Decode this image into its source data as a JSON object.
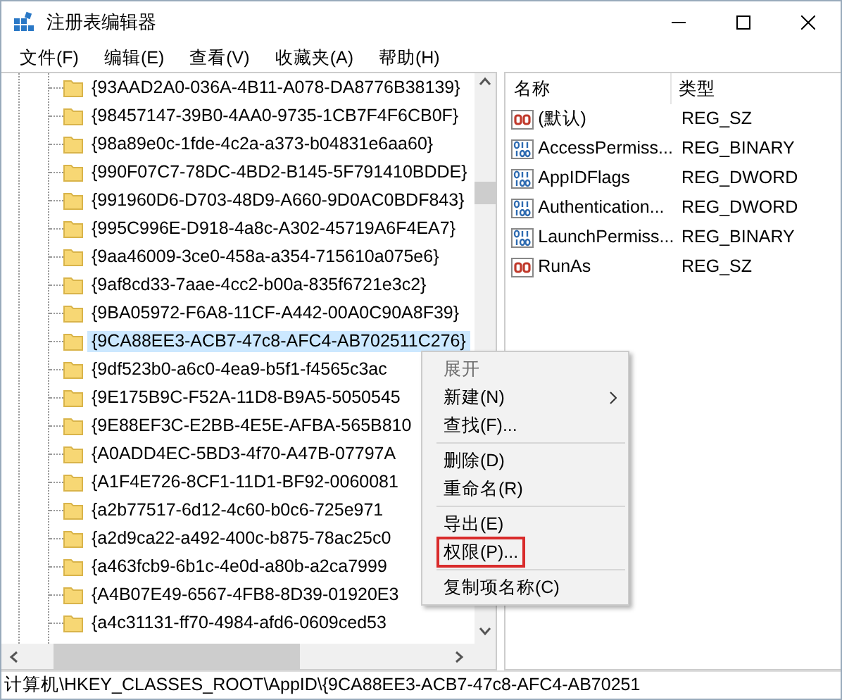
{
  "window": {
    "title": "注册表编辑器"
  },
  "menu": [
    "文件(F)",
    "编辑(E)",
    "查看(V)",
    "收藏夹(A)",
    "帮助(H)"
  ],
  "tree": {
    "items": [
      {
        "label": "{93AAD2A0-036A-4B11-A078-DA8776B38139}",
        "selected": false
      },
      {
        "label": "{98457147-39B0-4AA0-9735-1CB7F4F6CB0F}",
        "selected": false
      },
      {
        "label": "{98a89e0c-1fde-4c2a-a373-b04831e6aa60}",
        "selected": false
      },
      {
        "label": "{990F07C7-78DC-4BD2-B145-5F791410BDDE}",
        "selected": false
      },
      {
        "label": "{991960D6-D703-48D9-A660-9D0AC0BDF843}",
        "selected": false
      },
      {
        "label": "{995C996E-D918-4a8c-A302-45719A6F4EA7}",
        "selected": false
      },
      {
        "label": "{9aa46009-3ce0-458a-a354-715610a075e6}",
        "selected": false
      },
      {
        "label": "{9af8cd33-7aae-4cc2-b00a-835f6721e3c2}",
        "selected": false
      },
      {
        "label": "{9BA05972-F6A8-11CF-A442-00A0C90A8F39}",
        "selected": false
      },
      {
        "label": "{9CA88EE3-ACB7-47c8-AFC4-AB702511C276}",
        "selected": true
      },
      {
        "label": "{9df523b0-a6c0-4ea9-b5f1-f4565c3ac",
        "selected": false
      },
      {
        "label": "{9E175B9C-F52A-11D8-B9A5-5050545",
        "selected": false
      },
      {
        "label": "{9E88EF3C-E2BB-4E5E-AFBA-565B810",
        "selected": false
      },
      {
        "label": "{A0ADD4EC-5BD3-4f70-A47B-07797A",
        "selected": false
      },
      {
        "label": "{A1F4E726-8CF1-11D1-BF92-0060081",
        "selected": false
      },
      {
        "label": "{a2b77517-6d12-4c60-b0c6-725e971",
        "selected": false
      },
      {
        "label": "{a2d9ca22-a492-400c-b875-78ac25c0",
        "selected": false
      },
      {
        "label": "{a463fcb9-6b1c-4e0d-a80b-a2ca7999",
        "selected": false
      },
      {
        "label": "{A4B07E49-6567-4FB8-8D39-01920E3",
        "selected": false
      },
      {
        "label": "{a4c31131-ff70-4984-afd6-0609ced53",
        "selected": false
      }
    ]
  },
  "values": {
    "columns": [
      "名称",
      "类型"
    ],
    "rows": [
      {
        "kind": "string",
        "name": "(默认)",
        "type": "REG_SZ"
      },
      {
        "kind": "binary",
        "name": "AccessPermiss...",
        "type": "REG_BINARY"
      },
      {
        "kind": "binary",
        "name": "AppIDFlags",
        "type": "REG_DWORD"
      },
      {
        "kind": "binary",
        "name": "Authentication...",
        "type": "REG_DWORD"
      },
      {
        "kind": "binary",
        "name": "LaunchPermiss...",
        "type": "REG_BINARY"
      },
      {
        "kind": "string",
        "name": "RunAs",
        "type": "REG_SZ"
      }
    ]
  },
  "context_menu": [
    {
      "kind": "item",
      "label": "展开",
      "disabled": true,
      "submenu": false,
      "highlighted": false
    },
    {
      "kind": "item",
      "label": "新建(N)",
      "disabled": false,
      "submenu": true,
      "highlighted": false
    },
    {
      "kind": "item",
      "label": "查找(F)...",
      "disabled": false,
      "submenu": false,
      "highlighted": false
    },
    {
      "kind": "separator"
    },
    {
      "kind": "item",
      "label": "删除(D)",
      "disabled": false,
      "submenu": false,
      "highlighted": false
    },
    {
      "kind": "item",
      "label": "重命名(R)",
      "disabled": false,
      "submenu": false,
      "highlighted": false
    },
    {
      "kind": "separator"
    },
    {
      "kind": "item",
      "label": "导出(E)",
      "disabled": false,
      "submenu": false,
      "highlighted": false
    },
    {
      "kind": "item",
      "label": "权限(P)...",
      "disabled": false,
      "submenu": false,
      "highlighted": true
    },
    {
      "kind": "separator"
    },
    {
      "kind": "item",
      "label": "复制项名称(C)",
      "disabled": false,
      "submenu": false,
      "highlighted": false
    }
  ],
  "status_bar": "计算机\\HKEY_CLASSES_ROOT\\AppID\\{9CA88EE3-ACB7-47c8-AFC4-AB70251"
}
